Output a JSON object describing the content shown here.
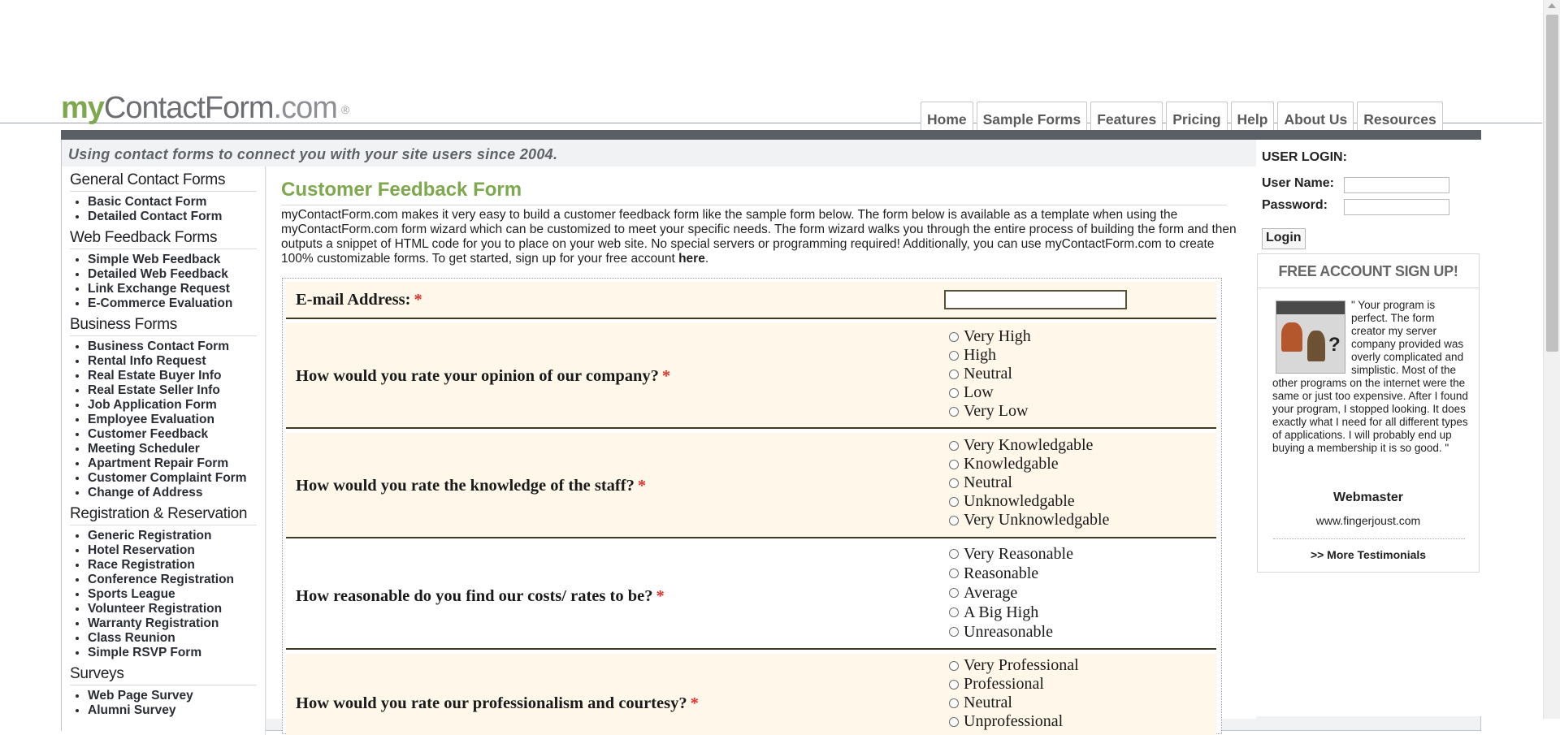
{
  "header": {
    "logo": {
      "my": "my",
      "contact": "ContactForm",
      "dotcom": ".com",
      "reg": "®"
    },
    "nav": [
      "Home",
      "Sample Forms",
      "Features",
      "Pricing",
      "Help",
      "About Us",
      "Resources"
    ],
    "tagline": "Using contact forms to connect you with your site users since 2004."
  },
  "sidebar": {
    "sections": [
      {
        "heading": "General Contact Forms",
        "items": [
          "Basic Contact Form",
          "Detailed Contact Form"
        ]
      },
      {
        "heading": "Web Feedback Forms",
        "items": [
          "Simple Web Feedback",
          "Detailed Web Feedback",
          "Link Exchange Request",
          "E-Commerce Evaluation"
        ]
      },
      {
        "heading": "Business Forms",
        "items": [
          "Business Contact Form",
          "Rental Info Request",
          "Real Estate Buyer Info",
          "Real Estate Seller Info",
          "Job Application Form",
          "Employee Evaluation",
          "Customer Feedback",
          "Meeting Scheduler",
          "Apartment Repair Form",
          "Customer Complaint Form",
          "Change of Address"
        ]
      },
      {
        "heading": "Registration & Reservation",
        "items": [
          "Generic Registration",
          "Hotel Reservation",
          "Race Registration",
          "Conference Registration",
          "Sports League",
          "Volunteer Registration",
          "Warranty Registration",
          "Class Reunion",
          "Simple RSVP Form"
        ]
      },
      {
        "heading": "Surveys",
        "items": [
          "Web Page Survey",
          "Alumni Survey"
        ]
      }
    ]
  },
  "main": {
    "title": "Customer Feedback Form",
    "intro": "myContactForm.com makes it very easy to build a customer feedback form like the sample form below. The form below is available as a template when using the myContactForm.com form wizard which can be customized to meet your specific needs. The form wizard walks you through the entire process of building the form and then outputs a snippet of HTML code for you to place on your web site. No special servers or programming required! Additionally, you can use myContactForm.com to create 100% customizable forms. To get started, sign up for your free account ",
    "intro_link": "here",
    "intro_end": "."
  },
  "form": {
    "required_mark": "*",
    "email_label": "E-mail Address:",
    "questions": [
      {
        "label": "How would you rate your opinion of our company?",
        "options": [
          "Very High",
          "High",
          "Neutral",
          "Low",
          "Very Low"
        ]
      },
      {
        "label": "How would you rate the knowledge of the staff?",
        "options": [
          "Very Knowledgable",
          "Knowledgable",
          "Neutral",
          "Unknowledgable",
          "Very Unknowledgable"
        ]
      },
      {
        "label": "How reasonable do you find our costs/ rates to be?",
        "options": [
          "Very Reasonable",
          "Reasonable",
          "Average",
          "A Big High",
          "Unreasonable"
        ]
      },
      {
        "label": "How would you rate our professionalism and courtesy?",
        "options": [
          "Very Professional",
          "Professional",
          "Neutral",
          "Unprofessional"
        ]
      }
    ]
  },
  "login": {
    "heading": "USER LOGIN:",
    "username_label": "User Name:",
    "password_label": "Password:",
    "button": "Login"
  },
  "signup": {
    "label": "FREE ACCOUNT SIGN UP!"
  },
  "testimonial": {
    "quote": "\" Your program is perfect. The form creator my server company provided was overly complicated and simplistic. Most of the other programs on the internet were the same or just too expensive. After I found your program, I stopped looking. It does exactly what I need for all different types of applications. I will probably end up buying a membership it is so good. \"",
    "name": "Webmaster",
    "url": "www.fingerjoust.com",
    "more": ">> More Testimonials"
  }
}
